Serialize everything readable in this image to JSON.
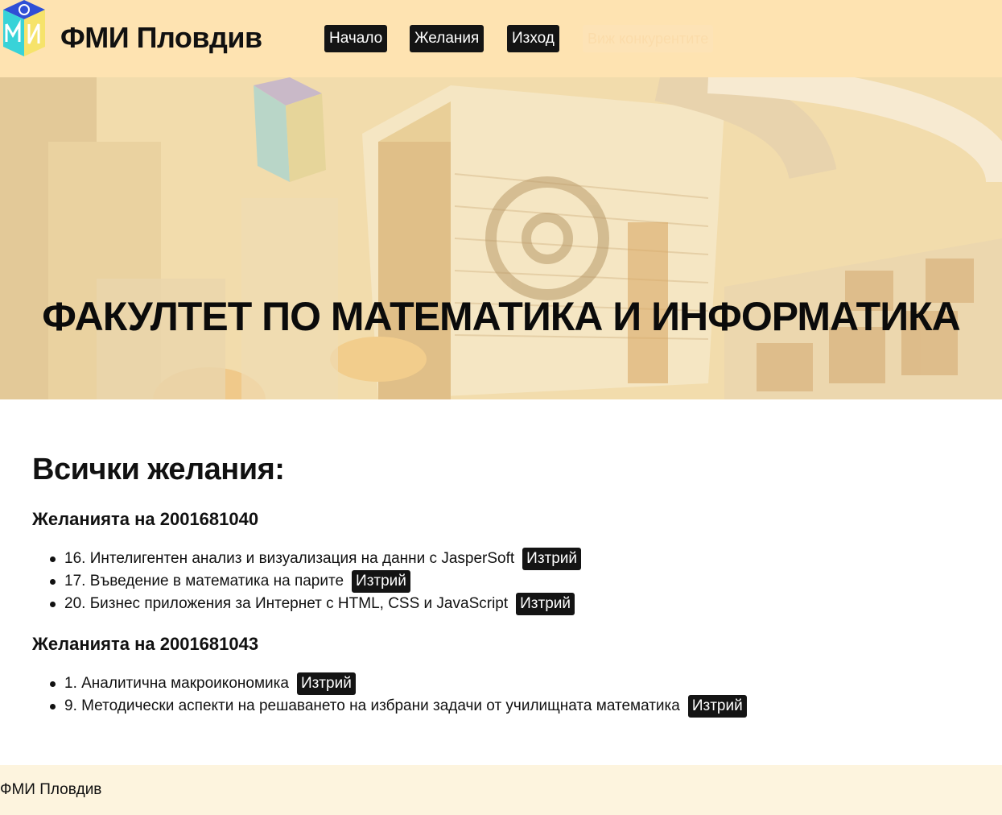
{
  "header": {
    "site_title": "ФМИ Пловдив",
    "nav": [
      {
        "label": "Начало"
      },
      {
        "label": "Желания"
      },
      {
        "label": "Изход"
      }
    ],
    "hidden_nav_label": "Виж конкурентите"
  },
  "hero": {
    "title": "ФАКУЛТЕТ ПО МАТЕМАТИКА И ИНФОРМАТИКА"
  },
  "main": {
    "heading": "Всички желания:",
    "groups": [
      {
        "heading": "Желанията на 2001681040",
        "items": [
          {
            "text": "16. Интелигентен анализ и визуализация на данни с JasperSoft",
            "button": "Изтрий"
          },
          {
            "text": "17. Въведение в математика на парите",
            "button": "Изтрий"
          },
          {
            "text": "20. Бизнес приложения за Интернет с HTML, CSS и JavaScript",
            "button": "Изтрий"
          }
        ]
      },
      {
        "heading": "Желанията на 2001681043",
        "items": [
          {
            "text": "1. Аналитична макроикономика",
            "button": "Изтрий"
          },
          {
            "text": "9. Методически аспекти на решаването на избрани задачи от училищната математика",
            "button": "Изтрий"
          }
        ]
      }
    ]
  },
  "footer": {
    "text": "ФМИ Пловдив"
  },
  "colors": {
    "header_bg": "#fee3b1",
    "button_bg": "#141414",
    "footer_bg": "#fdf4de"
  }
}
